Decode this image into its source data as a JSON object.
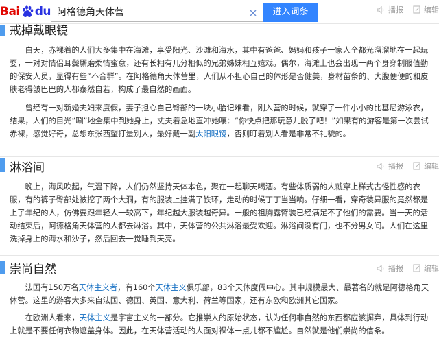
{
  "logo": {
    "part1": "Bai",
    "part2": "du",
    "part3": "百科"
  },
  "search": {
    "value": "阿格德角天体营",
    "button": "进入词条"
  },
  "top_actions": {
    "edit": "编辑"
  },
  "section0": {
    "title": "戒掉戴眼镜",
    "p1": "白天，赤裸着的人们大多集中在海滩，享受阳光、沙滩和海水，其中有爸爸、妈妈和孩子一家人全都光溜溜地在一起玩耍，一对对情侣耳鬓厮磨柔情蜜意，还有长相有几分相似的兄弟姊妹相互嬉戏。偶尔，海滩上也会出现一两个身穿制服值勤的保安人员，显得有些“不合群”。在阿格德角天体营里，人们从不担心自己的体形是否健美，身材苗条的、大腹便便的和皮肤老得皱巴巴的人都泰然自若，构成了最自然的画面。",
    "p2a": "曾经有一对新婚夫妇来度假，妻子担心自己臀部的一块小胎记难看，刚入营的时候，就穿了一件小小的比基尼游泳衣，结果，人们的目光“唰”地全集中到她身上，丈夫着急地直冲她嚷：“你快点把那玩意儿脱了吧！”如果有的游客是第一次尝试赤裸，感觉好奇，总想东张西望打量别人，最好戴一副",
    "p2link": "太阳眼镜",
    "p2b": "，否则盯着别人看是非常不礼貌的。"
  },
  "section1": {
    "title": "淋浴间",
    "action_record": "播报",
    "action_edit": "编辑",
    "p1": "晚上，海风吹起，气温下降，人们仍然坚持天体本色，聚在一起聊天喝酒。有些体质弱的人就穿上样式古怪性感的衣服，有的裤子臀部处被挖了两个大洞，有的服装上挂满了铁环，走动的时候丁丁当当响。仔细一看，穿奇装异服的竟然都是上了年纪的人，仿佛要跟年轻人一较高下，年纪越大服装越奇异。一般的祖胸露臂装已经满足不了他们的需要。当一天的活动结束后，阿德格角天体营的人都去淋浴。其中，天体营的公共淋浴最受欢迎。淋浴间没有门，也不分男女间。人们在这里洗掉身上的海水和沙子，然后回去一觉睡到天亮。"
  },
  "section2": {
    "title": "崇尚自然",
    "action_record": "播报",
    "action_edit": "编辑",
    "p1a": "法国有150万名",
    "p1link1": "天体主义者",
    "p1b": "，有160个",
    "p1link2": "天体主义",
    "p1c": "俱乐部，83个天体度假中心。其中规模最大、最著名的就是阿德格角天体营。这里的游客大多来自法国、德国、英国、意大利、荷兰等国家，还有东欧和欧洲其它国家。",
    "p2a": "在欧洲人看来，",
    "p2link": "天体主义",
    "p2b": "是宇宙主义的一部分。它推崇人的原始状态，认为任何非自然的东西都应该摒弃，具体到行动上就是不要任何衣物遮盖身体。因此，在天体营活动的人面对裸体一点儿都不尴尬。自然就是他们崇尚的信条。"
  },
  "colors": {
    "accent": "#4f9cee",
    "button": "#3385ff",
    "link": "#136ec2"
  }
}
